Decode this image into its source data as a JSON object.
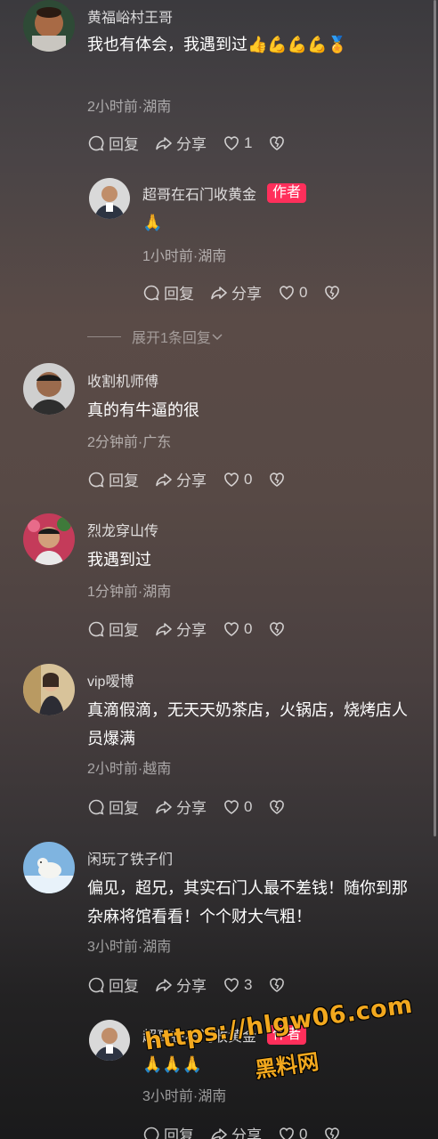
{
  "comments": [
    {
      "username": "黄福峪村王哥",
      "text": "我也有体会，我遇到过👍💪💪💪🏅",
      "meta": "2小时前·湖南",
      "reply_label": "回复",
      "share_label": "分享",
      "likes": "1",
      "avatar_icon": "user-avatar",
      "reply": {
        "username": "超哥在石门收黄金",
        "badge": "作者",
        "text": "🙏",
        "meta": "1小时前·湖南",
        "reply_label": "回复",
        "share_label": "分享",
        "likes": "0",
        "avatar_icon": "user-avatar"
      },
      "expand_label": "展开1条回复"
    },
    {
      "username": "收割机师傅",
      "text": "真的有牛逼的很",
      "meta": "2分钟前·广东",
      "reply_label": "回复",
      "share_label": "分享",
      "likes": "0",
      "avatar_icon": "user-avatar"
    },
    {
      "username": "烈龙穿山传",
      "text": "我遇到过",
      "meta": "1分钟前·湖南",
      "reply_label": "回复",
      "share_label": "分享",
      "likes": "0",
      "avatar_icon": "user-avatar"
    },
    {
      "username": "vip嗳博",
      "text": "真滴假滴，无天天奶茶店，火锅店，烧烤店人员爆满",
      "meta": "2小时前·越南",
      "reply_label": "回复",
      "share_label": "分享",
      "likes": "0",
      "avatar_icon": "user-avatar"
    },
    {
      "username": "闲玩了铁子们",
      "text": "偏见，超兄，其实石门人最不差钱！随你到那杂麻将馆看看！个个财大气粗！",
      "meta": "3小时前·湖南",
      "reply_label": "回复",
      "share_label": "分享",
      "likes": "3",
      "avatar_icon": "polar-bear-avatar",
      "reply": {
        "username": "超哥在石门收黄金",
        "badge": "作者",
        "text": "🙏🙏🙏",
        "meta": "3小时前·湖南",
        "reply_label": "回复",
        "share_label": "分享",
        "likes": "0",
        "avatar_icon": "user-avatar"
      }
    }
  ],
  "watermark": {
    "url": "https://hlgw06.com",
    "name": "黑料网"
  },
  "colors": {
    "author_badge": "#ff2f5b",
    "watermark": "#f2a81e"
  }
}
